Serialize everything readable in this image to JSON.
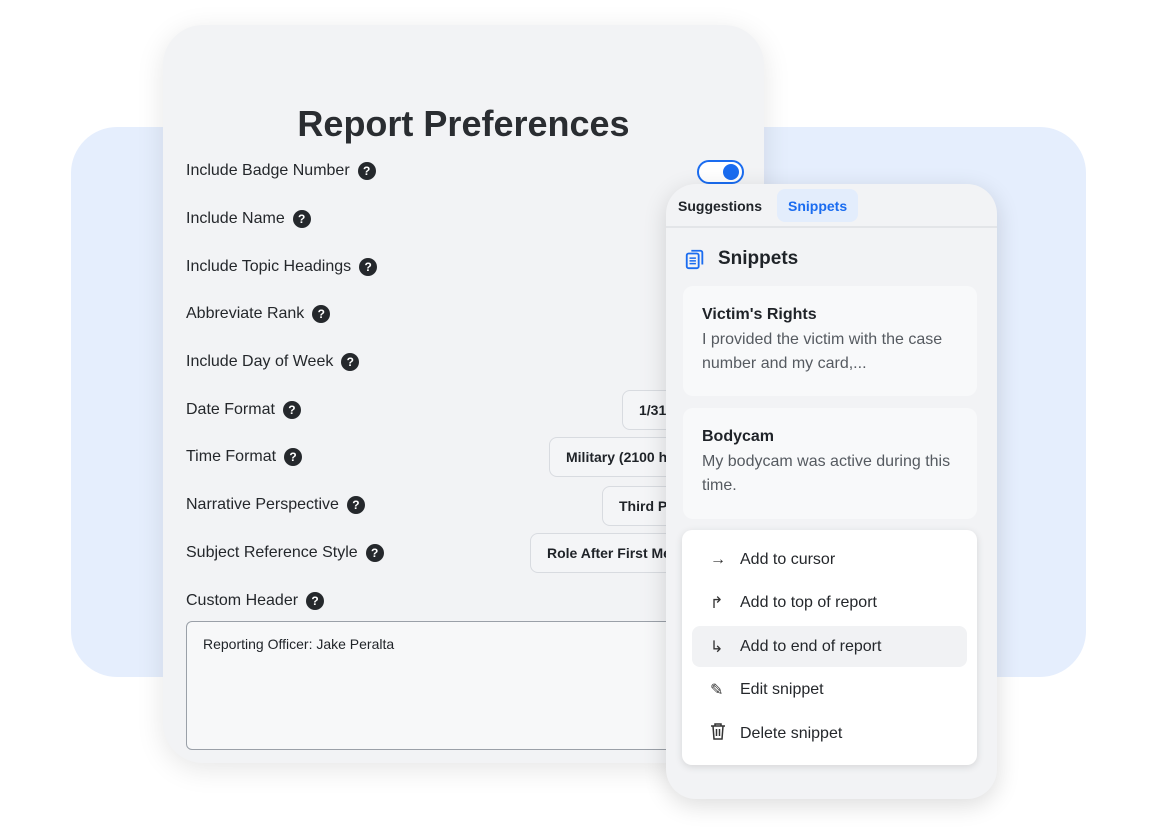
{
  "preferences": {
    "title": "Report Preferences",
    "rows": [
      {
        "label": "Include Badge Number"
      },
      {
        "label": "Include Name"
      },
      {
        "label": "Include Topic Headings"
      },
      {
        "label": "Abbreviate Rank"
      },
      {
        "label": "Include Day of Week"
      },
      {
        "label": "Date Format",
        "value": "1/31/"
      },
      {
        "label": "Time Format",
        "value": "Military (2100 h"
      },
      {
        "label": "Narrative Perspective",
        "value": "Third P"
      },
      {
        "label": "Subject Reference Style",
        "value": "Role After First Me"
      },
      {
        "label": "Custom Header"
      }
    ],
    "help_glyph": "?",
    "badge_toggle_on": true,
    "custom_header_value": "Reporting Officer: Jake Peralta"
  },
  "side_panel": {
    "tabs": [
      {
        "label": "Suggestions"
      },
      {
        "label": "Snippets",
        "active": true
      }
    ],
    "heading": "Snippets",
    "snippets": [
      {
        "title": "Victim's Rights",
        "body": "I provided the victim with the case number and my card,..."
      },
      {
        "title": "Bodycam",
        "body": "My bodycam was active during this time."
      }
    ],
    "menu": [
      {
        "icon": "arrow-right-icon",
        "glyph": "→",
        "label": "Add to cursor"
      },
      {
        "icon": "corner-up-right-icon",
        "glyph": "↱",
        "label": "Add to top of report"
      },
      {
        "icon": "corner-down-right-icon",
        "glyph": "↳",
        "label": "Add to end of report",
        "highlighted": true
      },
      {
        "icon": "edit-icon",
        "glyph": "✎",
        "label": "Edit snippet"
      },
      {
        "icon": "trash-icon",
        "glyph": "🗑",
        "label": "Delete snippet"
      }
    ]
  },
  "colors": {
    "accent": "#1a6cf0",
    "background_panel": "#e5eefd"
  }
}
